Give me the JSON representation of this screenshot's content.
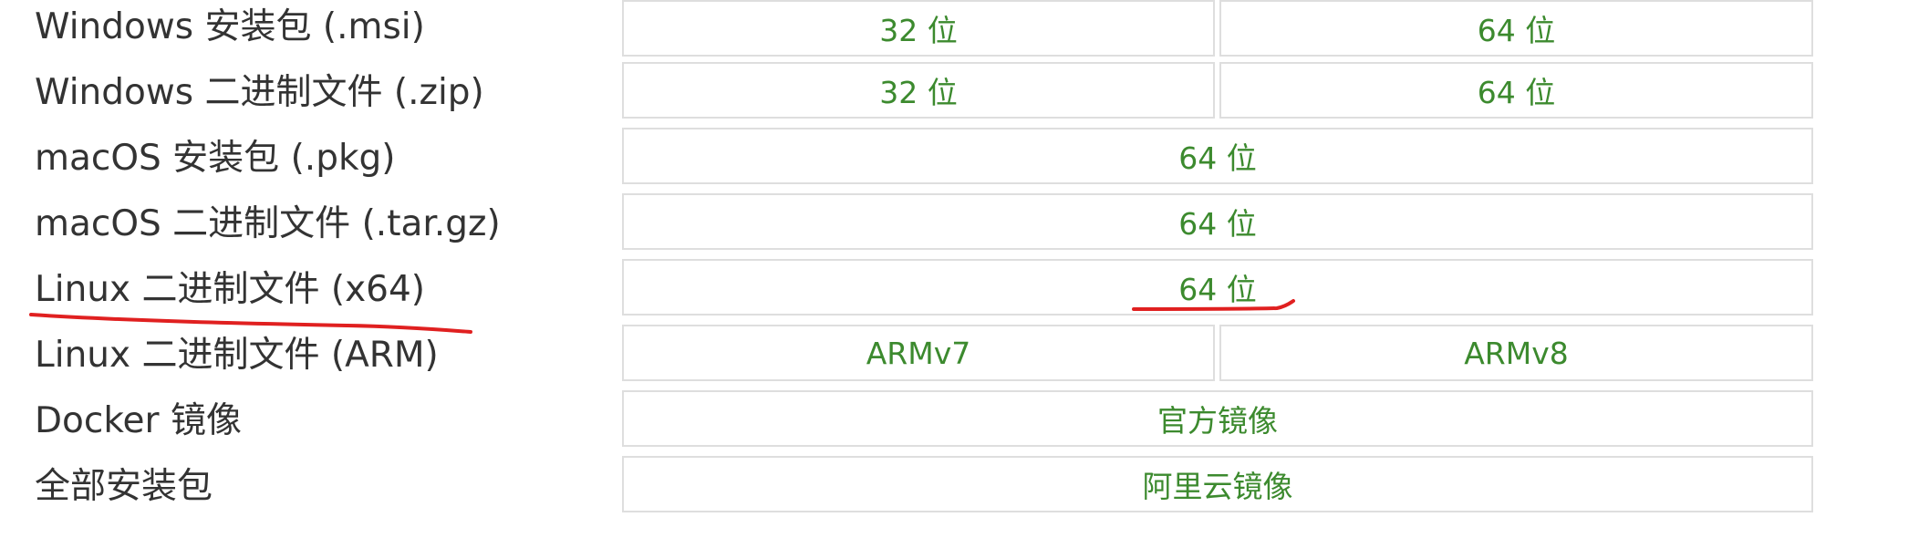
{
  "rows": [
    {
      "label": "Windows 安装包 (.msi)",
      "cells": [
        "32 位",
        "64 位"
      ]
    },
    {
      "label": "Windows 二进制文件 (.zip)",
      "cells": [
        "32 位",
        "64 位"
      ]
    },
    {
      "label": "macOS 安装包 (.pkg)",
      "cells": [
        "64 位"
      ]
    },
    {
      "label": "macOS 二进制文件 (.tar.gz)",
      "cells": [
        "64 位"
      ]
    },
    {
      "label": "Linux 二进制文件 (x64)",
      "cells": [
        "64 位"
      ]
    },
    {
      "label": "Linux 二进制文件 (ARM)",
      "cells": [
        "ARMv7",
        "ARMv8"
      ]
    },
    {
      "label": "Docker 镜像",
      "cells": [
        "官方镜像"
      ]
    },
    {
      "label": "全部安装包",
      "cells": [
        "阿里云镜像"
      ]
    }
  ],
  "colors": {
    "link": "#3c8a2e",
    "border": "#dedede",
    "label": "#333333",
    "annotation": "#e02020"
  }
}
